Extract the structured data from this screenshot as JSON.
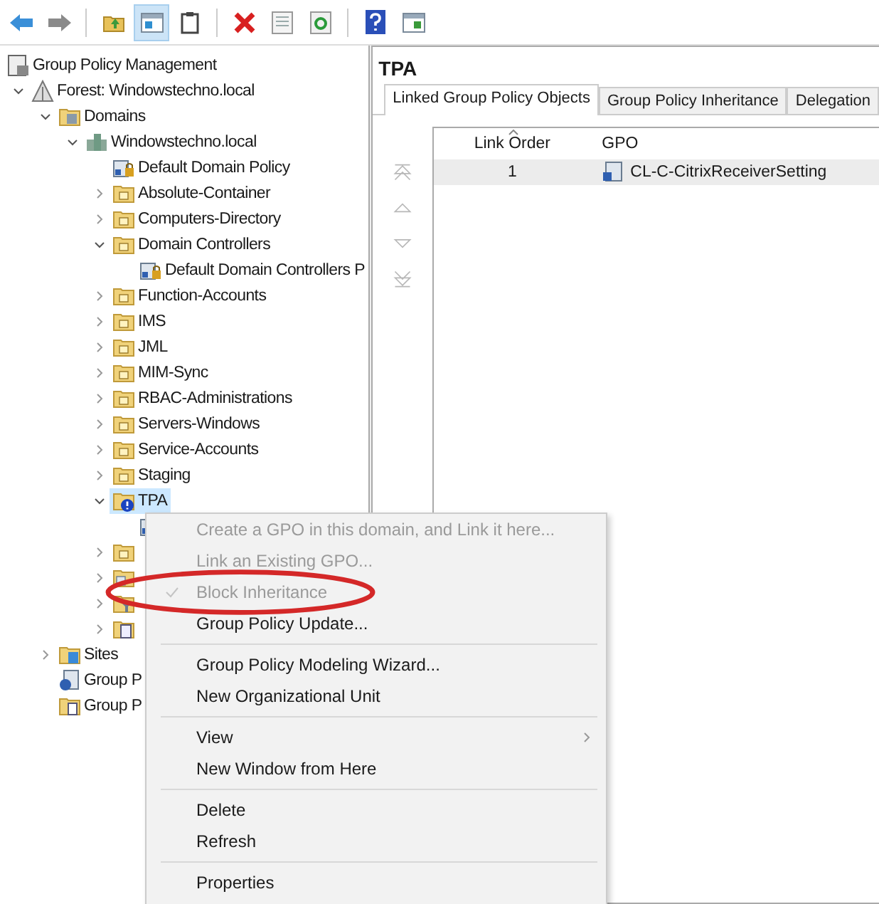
{
  "toolbar": [
    {
      "kind": "back",
      "pressed": false
    },
    {
      "kind": "forward",
      "pressed": false
    },
    {
      "kind": "up",
      "pressed": false
    },
    {
      "kind": "tree",
      "pressed": true
    },
    {
      "kind": "export",
      "pressed": false
    },
    {
      "kind": "delete",
      "pressed": false
    },
    {
      "kind": "properties",
      "pressed": false
    },
    {
      "kind": "refresh",
      "pressed": false
    },
    {
      "kind": "help",
      "pressed": false
    },
    {
      "kind": "action",
      "pressed": false
    }
  ],
  "tree": [
    {
      "label": "Group Policy Management",
      "kind": "gpm",
      "selected": false,
      "children": [
        {
          "label": "Forest: Windowstechno.local",
          "kind": "forest",
          "expanded": true,
          "selected": false,
          "children": [
            {
              "label": "Domains",
              "kind": "domains",
              "expanded": true,
              "selected": false,
              "children": [
                {
                  "label": "Windowstechno.local",
                  "kind": "domain",
                  "expanded": true,
                  "selected": false,
                  "children": [
                    {
                      "label": "Default Domain Policy",
                      "kind": "gpo",
                      "selected": false
                    },
                    {
                      "label": "Absolute-Container",
                      "kind": "ou",
                      "expanded": false,
                      "selected": false
                    },
                    {
                      "label": "Computers-Directory",
                      "kind": "ou",
                      "expanded": false,
                      "selected": false
                    },
                    {
                      "label": "Domain Controllers",
                      "kind": "ou",
                      "expanded": true,
                      "selected": false,
                      "children": [
                        {
                          "label": "Default Domain Controllers P",
                          "kind": "gpo",
                          "selected": false
                        }
                      ]
                    },
                    {
                      "label": "Function-Accounts",
                      "kind": "ou",
                      "expanded": false,
                      "selected": false
                    },
                    {
                      "label": "IMS",
                      "kind": "ou",
                      "expanded": false,
                      "selected": false
                    },
                    {
                      "label": "JML",
                      "kind": "ou",
                      "expanded": false,
                      "selected": false
                    },
                    {
                      "label": "MIM-Sync",
                      "kind": "ou",
                      "expanded": false,
                      "selected": false
                    },
                    {
                      "label": "RBAC-Administrations",
                      "kind": "ou",
                      "expanded": false,
                      "selected": false
                    },
                    {
                      "label": "Servers-Windows",
                      "kind": "ou",
                      "expanded": false,
                      "selected": false
                    },
                    {
                      "label": "Service-Accounts",
                      "kind": "ou",
                      "expanded": false,
                      "selected": false
                    },
                    {
                      "label": "Staging",
                      "kind": "ou",
                      "expanded": false,
                      "selected": false
                    },
                    {
                      "label": "TPA",
                      "kind": "ou-blocked",
                      "expanded": true,
                      "selected": true,
                      "children": [
                        {
                          "kind": "gpo",
                          "selected": false
                        }
                      ]
                    },
                    {
                      "kind": "ou",
                      "expanded": false,
                      "selected": false
                    },
                    {
                      "kind": "gpo-folder",
                      "expanded": false,
                      "selected": false
                    },
                    {
                      "kind": "filter",
                      "expanded": false,
                      "selected": false
                    },
                    {
                      "kind": "starter",
                      "expanded": false,
                      "selected": false
                    }
                  ]
                }
              ]
            },
            {
              "label": "Sites",
              "kind": "sites",
              "expanded": false,
              "selected": false
            },
            {
              "label": "Group P",
              "kind": "modeling",
              "selected": false
            },
            {
              "label": "Group P",
              "kind": "results",
              "selected": false
            }
          ]
        }
      ]
    }
  ],
  "details": {
    "title": "TPA",
    "tabs": [
      {
        "label": "Linked Group Policy Objects",
        "selected": true
      },
      {
        "label": "Group Policy Inheritance",
        "selected": false
      },
      {
        "label": "Delegation",
        "selected": false
      }
    ],
    "order_buttons": [
      {
        "kind": "top"
      },
      {
        "kind": "up"
      },
      {
        "kind": "down"
      },
      {
        "kind": "bottom"
      }
    ],
    "table": {
      "columns": [
        {
          "label": "Link Order",
          "sorted": true
        },
        {
          "label": "GPO",
          "sorted": false
        }
      ],
      "rows": [
        {
          "cells": [
            "1",
            "CL-C-CitrixReceiverSetting"
          ],
          "selected": true
        }
      ]
    }
  },
  "context_menu": {
    "groups": [
      [
        {
          "label": "Create a GPO in this domain, and Link it here...",
          "disabled": true,
          "checked": false,
          "submenu": false,
          "annotated": false
        },
        {
          "label": "Link an Existing GPO...",
          "disabled": true,
          "checked": false,
          "submenu": false,
          "annotated": false
        },
        {
          "label": "Block Inheritance",
          "disabled": true,
          "checked": true,
          "submenu": false,
          "annotated": true
        },
        {
          "label": "Group Policy Update...",
          "disabled": false,
          "checked": false,
          "submenu": false,
          "annotated": false
        }
      ],
      [
        {
          "label": "Group Policy Modeling Wizard...",
          "disabled": false,
          "checked": false,
          "submenu": false
        },
        {
          "label": "New Organizational Unit",
          "disabled": false,
          "checked": false,
          "submenu": false
        }
      ],
      [
        {
          "label": "View",
          "disabled": false,
          "checked": false,
          "submenu": true
        },
        {
          "label": "New Window from Here",
          "disabled": false,
          "checked": false,
          "submenu": false
        }
      ],
      [
        {
          "label": "Delete",
          "disabled": false,
          "checked": false,
          "submenu": false
        },
        {
          "label": "Refresh",
          "disabled": false,
          "checked": false,
          "submenu": false
        }
      ],
      [
        {
          "label": "Properties",
          "disabled": false,
          "checked": false,
          "submenu": false
        }
      ]
    ]
  }
}
